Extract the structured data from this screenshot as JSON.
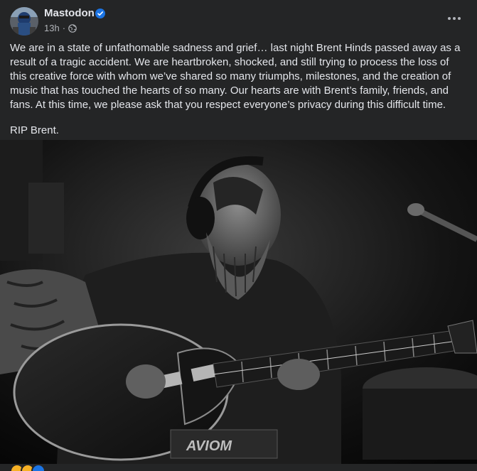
{
  "post": {
    "author": "Mastodon",
    "time": "13h",
    "dot": "·",
    "paragraphs": [
      "We are in a state of unfathomable sadness and grief… last night Brent Hinds passed away as a result of a tragic accident. We are heartbroken, shocked, and still trying to process the loss of this creative force with whom we’ve shared so many triumphs, milestones, and the creation of music that has touched the hearts of so many. Our hearts are with Brent’s family, friends, and fans. At this time, we please ask that you respect everyone’s privacy during this difficult time.",
      "RIP Brent."
    ],
    "photo_text": "AVIOM"
  },
  "icons": {
    "verified": "verified-badge-icon",
    "audience": "globe-icon",
    "menu": "more-options-icon"
  },
  "colors": {
    "background": "#242526",
    "primary_text": "#e4e6eb",
    "secondary_text": "#b0b3b8",
    "verified_blue": "#1b74e4"
  }
}
